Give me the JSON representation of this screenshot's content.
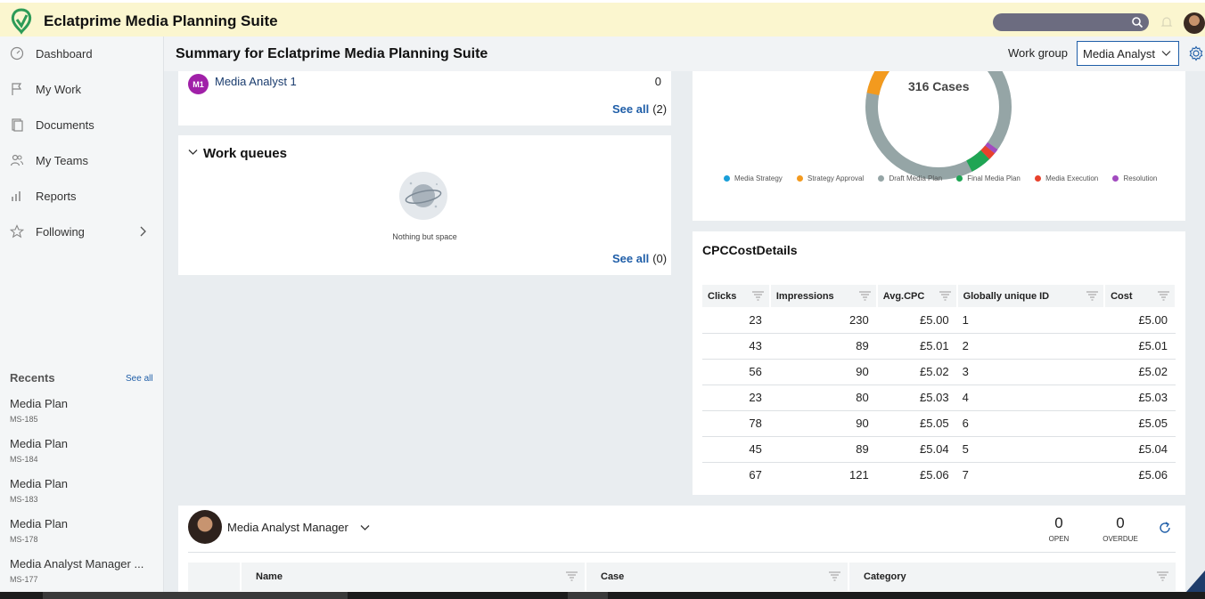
{
  "header": {
    "app_title": "Eclatprime Media Planning Suite",
    "search_placeholder": ""
  },
  "sidebar": {
    "items": [
      {
        "label": "Dashboard",
        "icon": "dashboard-icon"
      },
      {
        "label": "My Work",
        "icon": "flag-icon"
      },
      {
        "label": "Documents",
        "icon": "documents-icon"
      },
      {
        "label": "My Teams",
        "icon": "team-icon"
      },
      {
        "label": "Reports",
        "icon": "reports-icon"
      },
      {
        "label": "Following",
        "icon": "star-icon"
      }
    ],
    "recents_title": "Recents",
    "recents_see_all": "See all",
    "recents": [
      {
        "title": "Media Plan",
        "id": "MS-185"
      },
      {
        "title": "Media Plan",
        "id": "MS-184"
      },
      {
        "title": "Media Plan",
        "id": "MS-183"
      },
      {
        "title": "Media Plan",
        "id": "MS-178"
      },
      {
        "title": "Media Analyst Manager ...",
        "id": "MS-177"
      }
    ]
  },
  "page": {
    "title": "Summary for Eclatprime Media Planning Suite",
    "work_group_label": "Work group",
    "work_group_value": "Media Analyst"
  },
  "members_card": {
    "member_initials": "M1",
    "member_name": "Media Analyst 1",
    "member_count": "0",
    "see_all": "See all",
    "see_all_count": "(2)"
  },
  "work_queues": {
    "title": "Work queues",
    "empty_text": "Nothing but space",
    "see_all": "See all",
    "see_all_count": "(0)"
  },
  "cases_chart": {
    "center_label": "316 Cases",
    "colors": {
      "media_strategy": "#1a9fd9",
      "strategy_approval": "#f39a1e",
      "draft_media_plan": "#95a5a6",
      "final_media_plan": "#1fa554",
      "media_execution": "#e8412c",
      "resolution": "#a24bbf"
    },
    "legend": [
      "Media Strategy",
      "Strategy Approval",
      "Draft Media Plan",
      "Final Media Plan",
      "Media Execution",
      "Resolution"
    ]
  },
  "cpc_table": {
    "title": "CPCCostDetails",
    "columns": [
      "Clicks",
      "Impressions",
      "Avg.CPC",
      "Globally unique ID",
      "Cost"
    ],
    "rows": [
      [
        "23",
        "230",
        "£5.00",
        "1",
        "£5.00"
      ],
      [
        "43",
        "89",
        "£5.01",
        "2",
        "£5.01"
      ],
      [
        "56",
        "90",
        "£5.02",
        "3",
        "£5.02"
      ],
      [
        "23",
        "80",
        "£5.03",
        "4",
        "£5.03"
      ],
      [
        "78",
        "90",
        "£5.05",
        "6",
        "£5.05"
      ],
      [
        "45",
        "89",
        "£5.04",
        "5",
        "£5.04"
      ],
      [
        "67",
        "121",
        "£5.06",
        "7",
        "£5.06"
      ]
    ]
  },
  "manager_card": {
    "name": "Media Analyst Manager",
    "open_count": "0",
    "open_label": "OPEN",
    "overdue_count": "0",
    "overdue_label": "OVERDUE",
    "columns": [
      "Name",
      "Case",
      "Category"
    ]
  }
}
